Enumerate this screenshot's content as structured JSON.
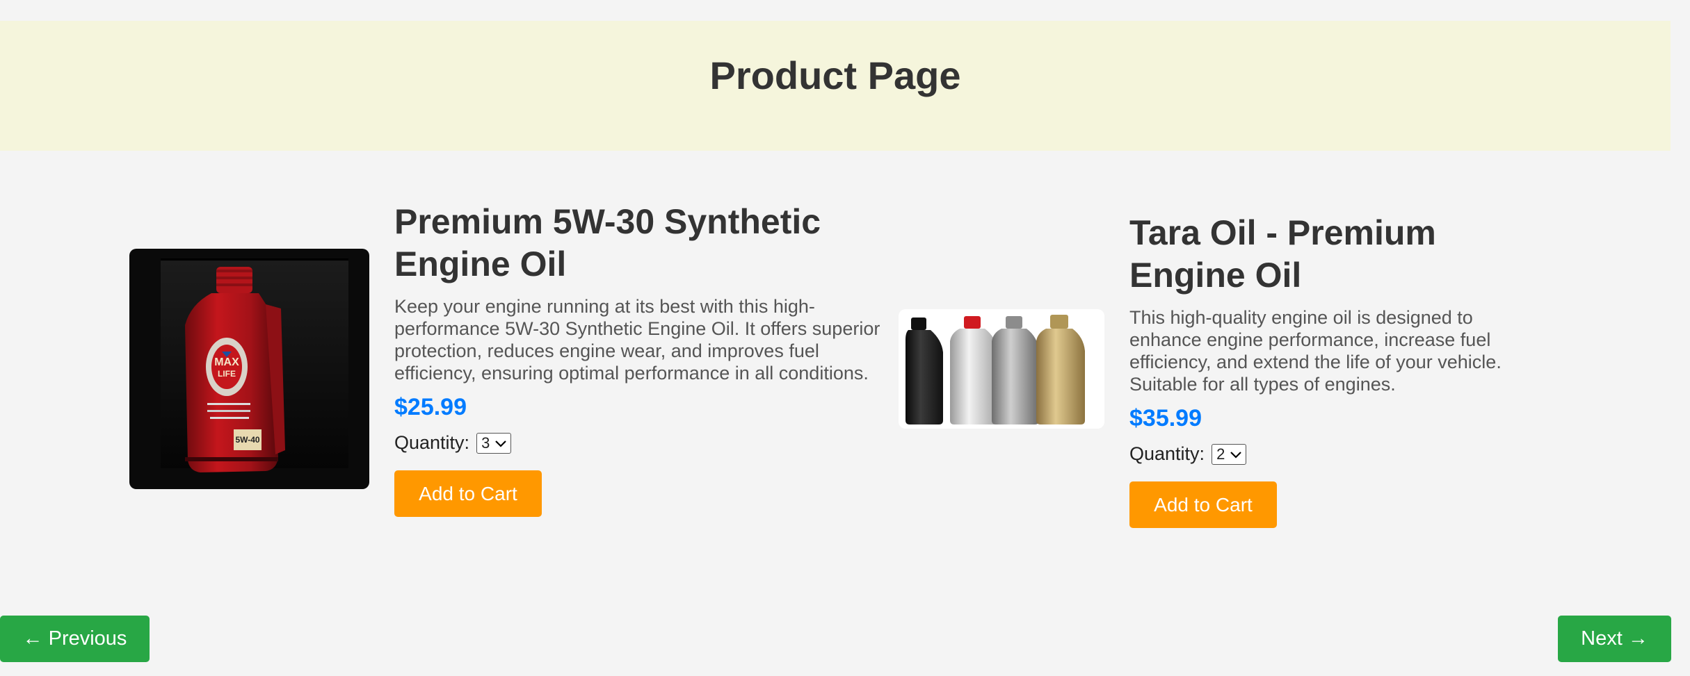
{
  "page": {
    "title": "Product Page"
  },
  "products": [
    {
      "title": "Premium 5W-30 Synthetic Engine Oil",
      "description": "Keep your engine running at its best with this high-performance 5W-30 Synthetic Engine Oil. It offers superior protection, reduces engine wear, and improves fuel efficiency, ensuring optimal performance in all conditions.",
      "price": "$25.99",
      "quantity_label": "Quantity:",
      "quantity": "3",
      "add_to_cart_label": "Add to Cart",
      "bottle_brand": "MAX LIFE",
      "bottle_grade": "5W-40"
    },
    {
      "title": "Tara Oil - Premium Engine Oil",
      "description": "This high-quality engine oil is designed to enhance engine performance, increase fuel efficiency, and extend the life of your vehicle. Suitable for all types of engines.",
      "price": "$35.99",
      "quantity_label": "Quantity:",
      "quantity": "2",
      "add_to_cart_label": "Add to Cart"
    }
  ],
  "navigation": {
    "previous_label": "← Previous",
    "next_label": "Next →"
  },
  "colors": {
    "header_bg": "#f5f5dc",
    "price": "#007bff",
    "add_to_cart": "#ff9800",
    "nav_button": "#28a745"
  }
}
